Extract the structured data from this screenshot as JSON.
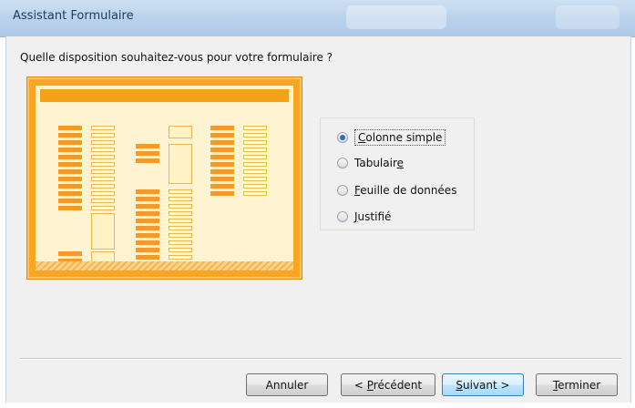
{
  "window": {
    "title": "Assistant Formulaire"
  },
  "wizard": {
    "question": "Quelle disposition souhaitez-vous pour votre formulaire ?",
    "selected_option": "Colonne simple",
    "options": [
      {
        "prefix": "",
        "mnemonic": "C",
        "rest": "olonne simple",
        "checked": true
      },
      {
        "prefix": "Tabulair",
        "mnemonic": "e",
        "rest": "",
        "checked": false
      },
      {
        "prefix": "",
        "mnemonic": "F",
        "rest": "euille de données",
        "checked": false
      },
      {
        "prefix": "",
        "mnemonic": "J",
        "rest": "ustifié",
        "checked": false
      }
    ],
    "preview_icon": "columnar-layout-preview"
  },
  "buttons": {
    "cancel": {
      "label": "Annuler"
    },
    "previous": {
      "prefix": "< ",
      "mnemonic": "P",
      "rest": "récédent"
    },
    "next": {
      "prefix": "",
      "mnemonic": "S",
      "rest": "uivant >"
    },
    "finish": {
      "prefix": "",
      "mnemonic": "T",
      "rest": "erminer"
    }
  },
  "colors": {
    "titlebar": "#bcd3ec",
    "dialog_bg": "#f0f0f0",
    "preview_orange": "#f6a623",
    "default_button": "#bee6fd"
  }
}
